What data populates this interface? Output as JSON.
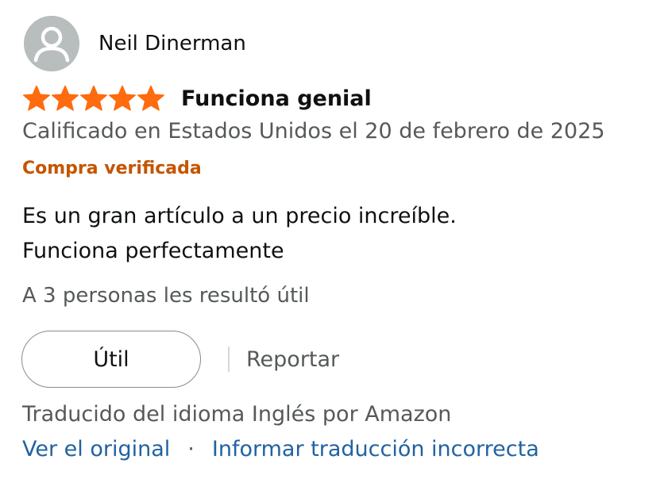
{
  "review": {
    "author": "Neil Dinerman",
    "rating": 5,
    "rating_max": 5,
    "title": "Funciona genial",
    "date": "Calificado en Estados Unidos el 20 de febrero de 2025",
    "verified": "Compra verificada",
    "body_lines": [
      "Es un gran artículo a un precio increíble.",
      "Funciona perfectamente"
    ],
    "helpful_text": "A 3 personas les resultó útil",
    "useful_label": "Útil",
    "report_label": "Reportar",
    "translated_text": "Traducido del idioma Inglés por Amazon",
    "view_original_label": "Ver el original",
    "separator": "·",
    "report_translation_label": "Informar traducción incorrecta"
  },
  "colors": {
    "star": "#FF6B0E",
    "verified": "#C45500",
    "link": "#2162A1",
    "muted": "#565959",
    "text": "#0F1111",
    "avatar_bg": "#B8BDBD"
  },
  "icons": {
    "avatar": "user-silhouette-icon",
    "star": "filled-star-icon"
  }
}
